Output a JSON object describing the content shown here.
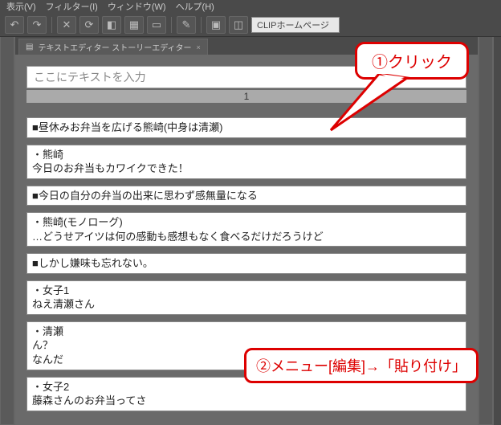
{
  "menubar": {
    "items": [
      "表示(V)",
      "フィルター(I)",
      "ウィンドウ(W)",
      "ヘルプ(H)"
    ]
  },
  "toolbar": {
    "field_label": "CLIPホームページ"
  },
  "tab": {
    "label": "テキストエディター ストーリーエディター",
    "close": "×"
  },
  "input": {
    "placeholder": "ここにテキストを入力"
  },
  "page_number": "1",
  "rows": [
    "■昼休みお弁当を広げる熊崎(中身は清瀬)",
    "・熊崎\n今日のお弁当もカワイクできた！",
    "■今日の自分の弁当の出来に思わず感無量になる",
    "・熊崎(モノローグ)\n…どうせアイツは何の感動も感想もなく食べるだけだろうけど",
    "■しかし嫌味も忘れない。",
    "・女子1\nねえ清瀬さん",
    "・清瀬\nん？\nなんだ",
    "・女子2\n藤森さんのお弁当ってさ"
  ],
  "callout1": "①クリック",
  "callout2": "②メニュー[編集]→「貼り付け」"
}
